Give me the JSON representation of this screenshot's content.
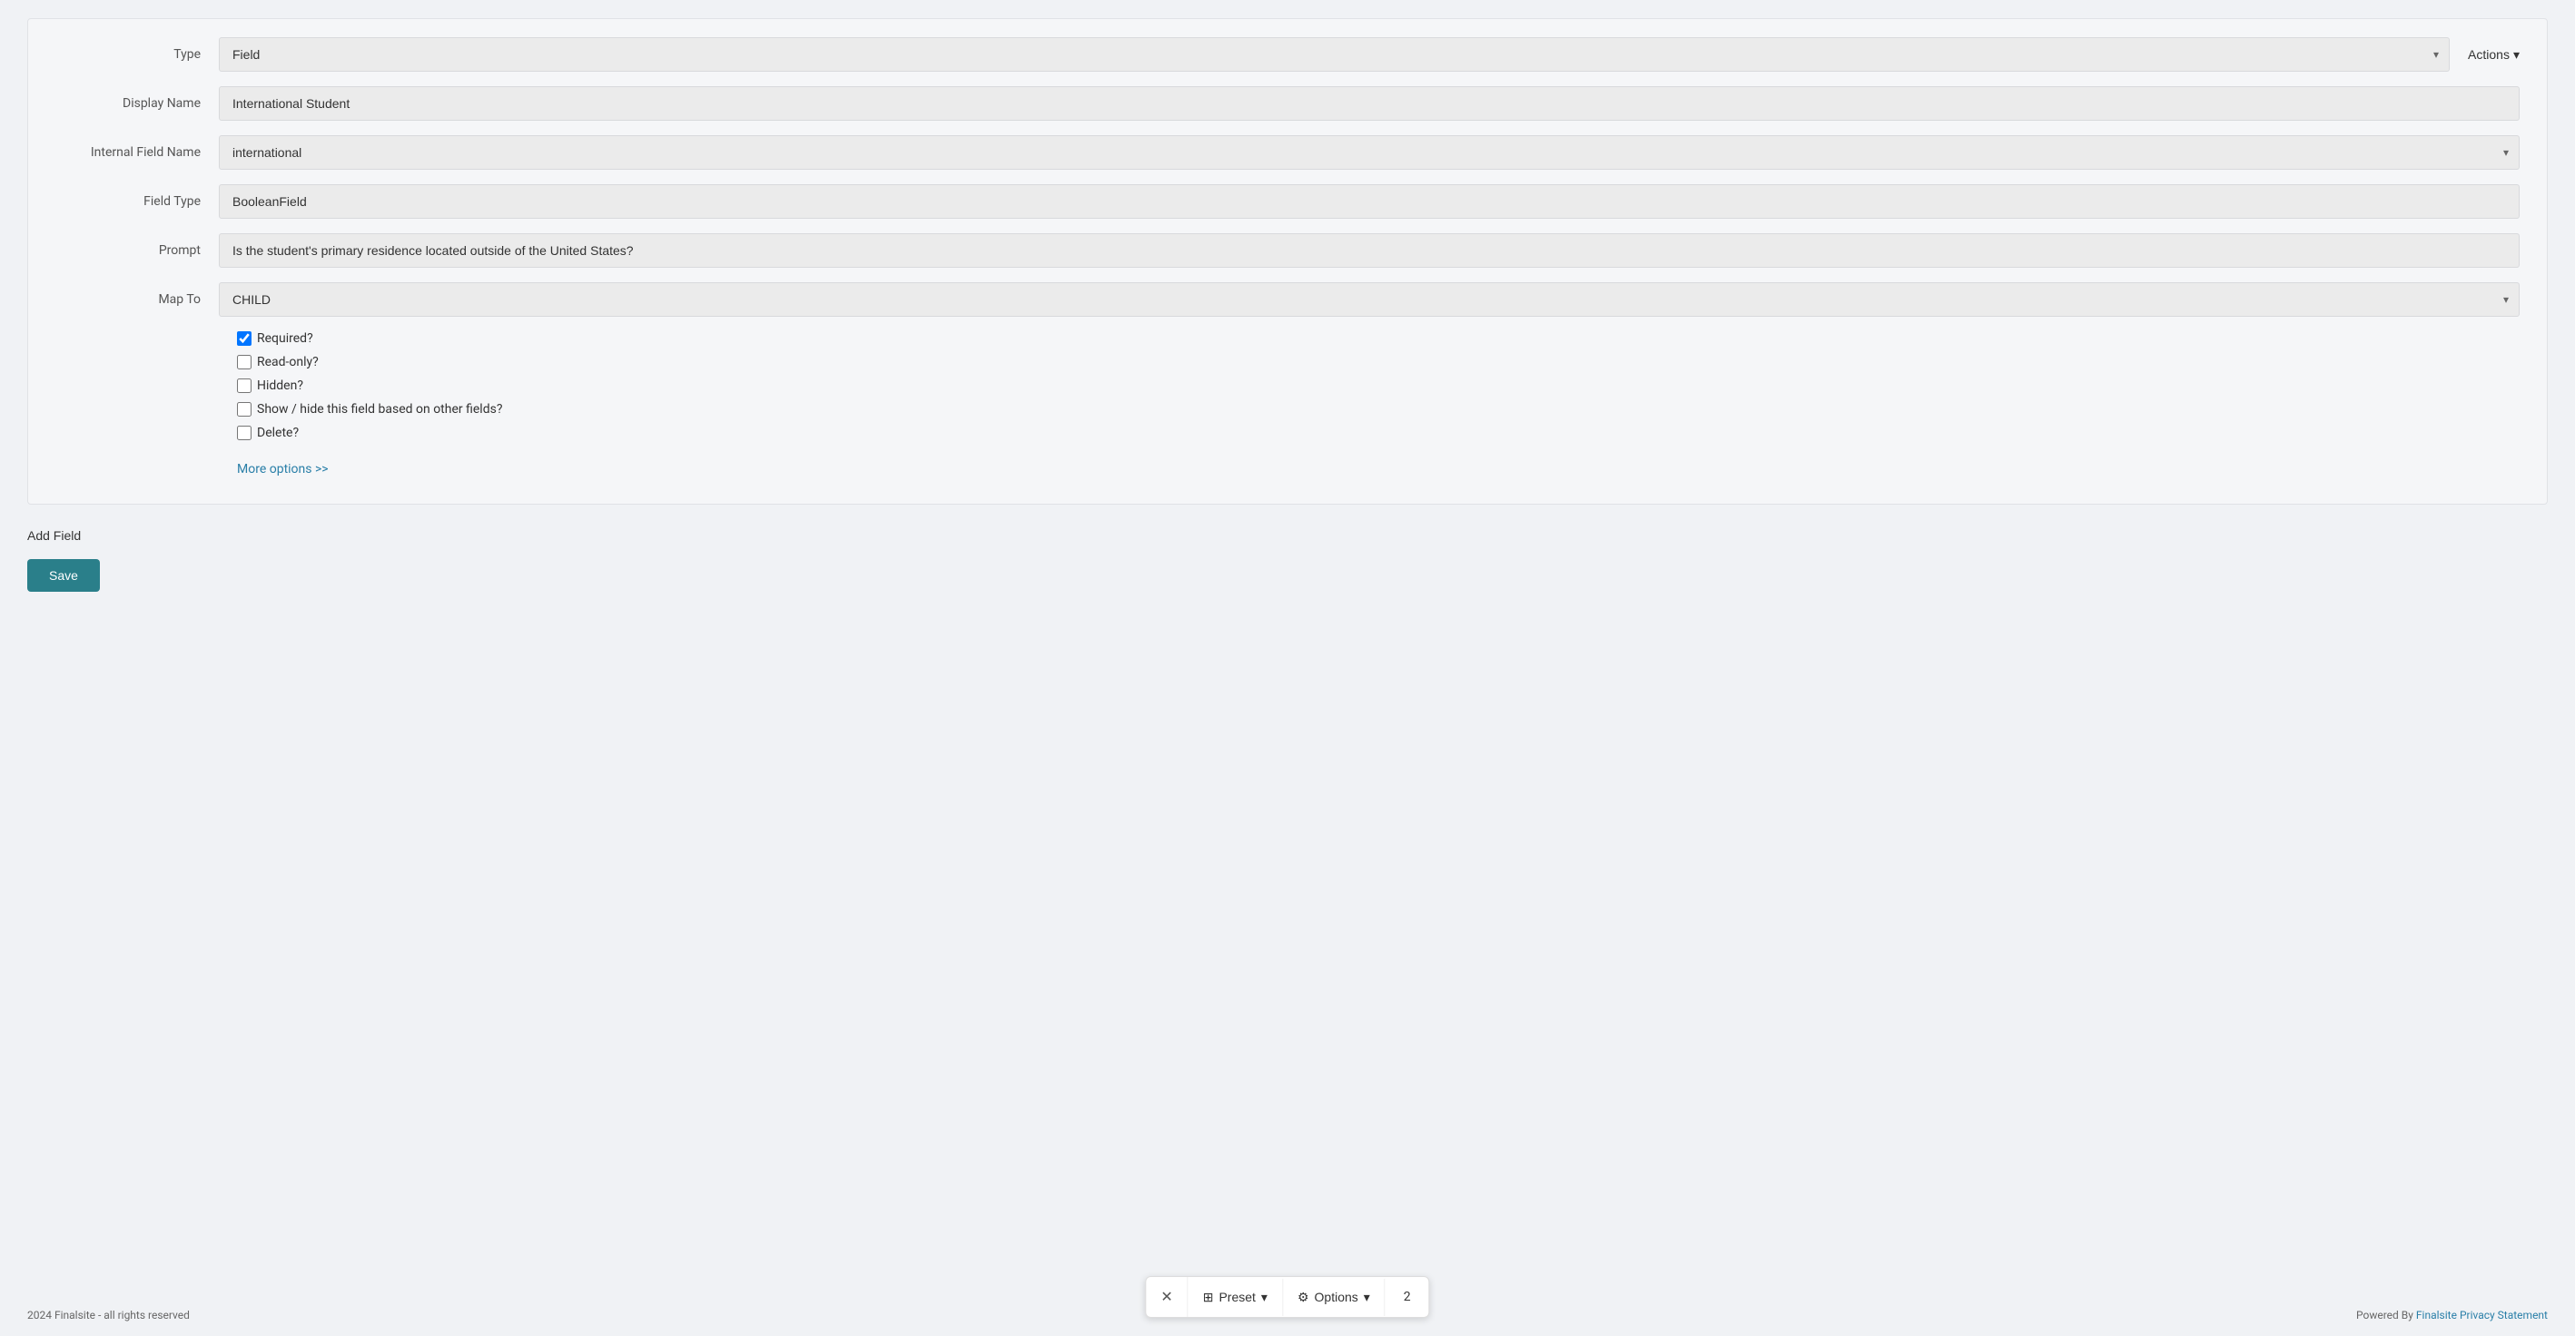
{
  "form": {
    "type_label": "Type",
    "type_value": "Field",
    "actions_label": "Actions",
    "display_name_label": "Display Name",
    "display_name_value": "International Student",
    "internal_field_name_label": "Internal Field Name",
    "internal_field_name_value": "international",
    "field_type_label": "Field Type",
    "field_type_value": "BooleanField",
    "prompt_label": "Prompt",
    "prompt_value": "Is the student's primary residence located outside of the United States?",
    "map_to_label": "Map To",
    "map_to_value": "CHILD",
    "checkboxes": [
      {
        "label": "Required?",
        "checked": true
      },
      {
        "label": "Read-only?",
        "checked": false
      },
      {
        "label": "Hidden?",
        "checked": false
      },
      {
        "label": "Show / hide this field based on other fields?",
        "checked": false
      },
      {
        "label": "Delete?",
        "checked": false
      }
    ],
    "more_options_label": "More options >>",
    "add_field_label": "Add Field",
    "save_label": "Save"
  },
  "footer": {
    "copyright": "2024 Finalsite - all rights reserved",
    "powered_by": "Powered By",
    "finalsite_link": "Finalsite",
    "privacy_link": "Privacy Statement"
  },
  "toolbar": {
    "close_icon": "✕",
    "preset_icon": "⊞",
    "preset_label": "Preset",
    "options_icon": "⚙",
    "options_label": "Options",
    "page_number": "2"
  },
  "icons": {
    "chevron_down": "▾",
    "actions_chevron": "▾"
  }
}
